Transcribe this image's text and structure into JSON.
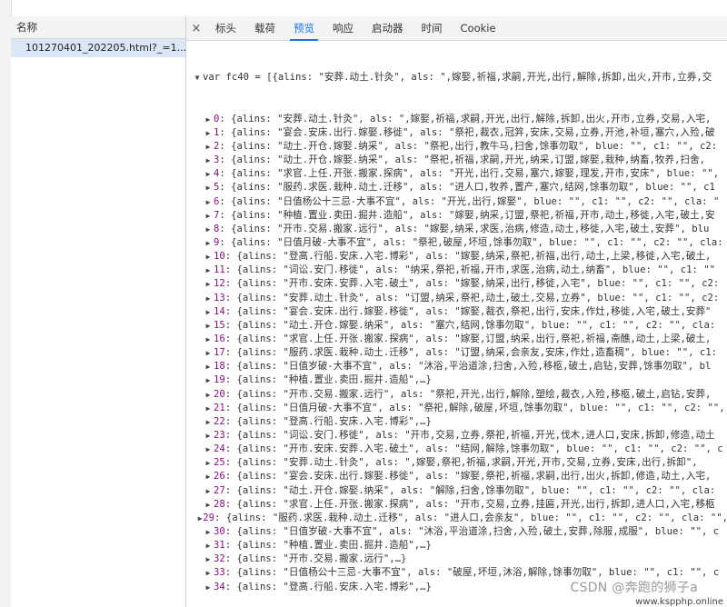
{
  "left": {
    "header": "名称",
    "file": "101270401_202205.html?_=1..."
  },
  "tabs": {
    "close": "×",
    "items": [
      {
        "label": "标头",
        "active": false
      },
      {
        "label": "载荷",
        "active": false
      },
      {
        "label": "预览",
        "active": true
      },
      {
        "label": "响应",
        "active": false
      },
      {
        "label": "启动器",
        "active": false
      },
      {
        "label": "时间",
        "active": false
      },
      {
        "label": "Cookie",
        "active": false
      }
    ]
  },
  "code": {
    "first_line": "var fc40 = [{alins: \"安葬.动土.针灸\", als: \",嫁娶,祈福,求嗣,开光,出行,解除,拆卸,出火,开市,立券,交",
    "items": [
      {
        "idx": "0",
        "text": "{alins: \"安葬.动土.针灸\", als: \",嫁娶,祈福,求嗣,开光,出行,解除,拆卸,出火,开市,立券,交易,入宅,"
      },
      {
        "idx": "1",
        "text": "{alins: \"宴会.安床.出行.嫁娶.移徙\", als: \"祭祀,裁衣,冠笄,安床,交易,立券,开池,补垣,塞穴,入殓,破"
      },
      {
        "idx": "2",
        "text": "{alins: \"动土.开仓.嫁娶.纳采\", als: \"祭祀,出行,教牛马,扫舍,馀事勿取\", blue: \"\", c1: \"\", c2:"
      },
      {
        "idx": "3",
        "text": "{alins: \"动土.开仓.嫁娶.纳采\", als: \"祭祀,祈福,求嗣,开光,纳采,订盟,嫁娶,栽种,纳畜,牧养,扫舍,"
      },
      {
        "idx": "4",
        "text": "{alins: \"求官.上任.开张.搬家.探病\", als: \"开光,出行,交易,塞穴,嫁娶,理发,开市,安床\", blue: \"\","
      },
      {
        "idx": "5",
        "text": "{alins: \"服药.求医.栽种.动土.迁移\", als: \"进人口,牧养,置产,塞穴,结网,馀事勿取\", blue: \"\", c1"
      },
      {
        "idx": "6",
        "text": "{alins: \"日值杨公十三忌-大事不宜\", als: \"开光,出行,嫁娶\", blue: \"\", c1: \"\", c2: \"\", cla: \""
      },
      {
        "idx": "7",
        "text": "{alins: \"种植.置业.卖田.掘井.造船\", als: \"嫁娶,纳采,订盟,祭祀,祈福,开市,动土,移徙,入宅,破土,安"
      },
      {
        "idx": "8",
        "text": "{alins: \"开市.交易.搬家.远行\", als: \"嫁娶,纳采,求医,治病,修造,动土,移徙,入宅,破土,安葬\", blu"
      },
      {
        "idx": "9",
        "text": "{alins: \"日值月破-大事不宜\", als: \"祭祀,破屋,坏垣,馀事勿取\", blue: \"\", c1: \"\", c2: \"\", cla:"
      },
      {
        "idx": "10",
        "text": "{alins: \"登高.行船.安床.入宅.博彩\", als: \"嫁娶,纳采,祭祀,祈福,出行,动土,上梁,移徙,入宅,破土,"
      },
      {
        "idx": "11",
        "text": "{alins: \"词讼.安门.移徙\", als: \"纳采,祭祀,祈福,开市,求医,治病,动土,纳畜\", blue: \"\", c1: \"\""
      },
      {
        "idx": "12",
        "text": "{alins: \"开市.安床.安葬.入宅.破土\", als: \"嫁娶,纳采,出行,移徙,入宅\", blue: \"\", c1: \"\", c2:"
      },
      {
        "idx": "13",
        "text": "{alins: \"安葬.动土.针灸\", als: \"订盟,纳采,祭祀,动土,破土,交易,立券\", blue: \"\", c1: \"\", c2:"
      },
      {
        "idx": "14",
        "text": "{alins: \"宴会.安床.出行.嫁娶.移徙\", als: \"嫁娶,裁衣,祭祀,出行,安床,作灶,移徙,入宅,破土,安葬\""
      },
      {
        "idx": "15",
        "text": "{alins: \"动土.开仓.嫁娶.纳采\", als: \"塞穴,结网,馀事勿取\", blue: \"\", c1: \"\", c2: \"\", cla:"
      },
      {
        "idx": "16",
        "text": "{alins: \"求官.上任.开张.搬家.探病\", als: \"嫁娶,订盟,纳采,出行,祭祀,祈福,斋醮,动土,上梁,破土,"
      },
      {
        "idx": "17",
        "text": "{alins: \"服药.求医.栽种.动土.迁移\", als: \"订盟,纳采,会亲友,安床,作灶,造畜稠\", blue: \"\", c1:"
      },
      {
        "idx": "18",
        "text": "{alins: \"日值岁破-大事不宜\", als: \"沐浴,平治道涂,扫舍,入殓,移柩,破土,启钻,安葬,馀事勿取\", bl"
      },
      {
        "idx": "19",
        "text": "{alins: \"种植.置业.卖田.掘井.造船\",…}"
      },
      {
        "idx": "20",
        "text": "{alins: \"开市.交易.搬家.远行\", als: \"祭祀,开光,出行,解除,塑绘,裁衣,入殓,移柩,破土,启钻,安葬,"
      },
      {
        "idx": "21",
        "text": "{alins: \"日值月破-大事不宜\", als: \"祭祀,解除,破屋,坏垣,馀事勿取\", blue: \"\", c1: \"\", c2: \"\","
      },
      {
        "idx": "22",
        "text": "{alins: \"登高.行船.安床.入宅.博彩\",…}"
      },
      {
        "idx": "23",
        "text": "{alins: \"词讼.安门.移徙\", als: \"开市,交易,立券,祭祀,祈福,开光,伐木,进人口,安床,拆卸,修造,动土"
      },
      {
        "idx": "24",
        "text": "{alins: \"开市.安床.安葬.入宅.破土\", als: \"结网,解除,馀事勿取\", blue: \"\", c1: \"\", c2: \"\", c"
      },
      {
        "idx": "25",
        "text": "{alins: \"安葬.动土.针灸\", als: \",嫁娶,祭祀,祈福,求嗣,开光,开市,交易,立券,安床,出行,拆卸\","
      },
      {
        "idx": "26",
        "text": "{alins: \"宴会.安床.出行.嫁娶.移徙\", als: \"嫁娶,祭祀,祈福,求嗣,出行,出火,拆卸,修造,动土,入宅,"
      },
      {
        "idx": "27",
        "text": "{alins: \"动土.开仓.嫁娶.纳采\", als: \"解除,扫舍,馀事勿取\", blue: \"\", c1: \"\", c2: \"\", cla:"
      },
      {
        "idx": "28",
        "text": "{alins: \"求官.上任.开张.搬家.探病\", als: \"开市,交易,立券,挂匾,开光,出行,拆卸,进人口,入宅,移柩"
      },
      {
        "idx": "29",
        "text": "{alins: \"服药.求医.栽种.动土.迁移\", als: \"进人口,会亲友\", blue: \"\", c1: \"\", c2: \"\", cla: \"\","
      },
      {
        "idx": "30",
        "text": "{alins: \"日值岁破-大事不宜\", als: \"沐浴,平治道涂,扫舍,入殓,破土,安葬,除服,成服\", blue: \"\", c"
      },
      {
        "idx": "31",
        "text": "{alins: \"种植.置业.卖田.掘井.造船\",…}"
      },
      {
        "idx": "32",
        "text": "{alins: \"开市.交易.搬家.远行\",…}"
      },
      {
        "idx": "33",
        "text": "{alins: \"日值杨公十三忌-大事不宜\", als: \"破屋,坏垣,沐浴,解除,馀事勿取\", blue: \"\", c1: \"\", c"
      },
      {
        "idx": "34",
        "text": "{alins: \"登高.行船.安床.入宅.博彩\",…}"
      }
    ]
  },
  "watermark": "CSDN @奔跑的狮子a",
  "watermark2": "www.kspphp.online"
}
